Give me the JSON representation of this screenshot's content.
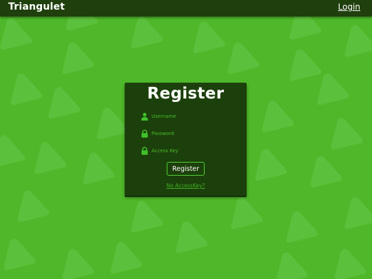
{
  "app": {
    "brand": "Triangulet"
  },
  "topbar": {
    "login_label": "Login"
  },
  "register": {
    "title": "Register",
    "fields": {
      "username": {
        "icon": "user-icon",
        "placeholder": "Username",
        "value": ""
      },
      "password": {
        "icon": "lock-icon",
        "placeholder": "Password",
        "value": ""
      },
      "access_key": {
        "icon": "lock-icon",
        "placeholder": "Access Key",
        "value": ""
      }
    },
    "submit_label": "Register",
    "no_access_key_link": "No AccessKey?"
  },
  "colors": {
    "background": "#4fb82a",
    "topbar": "#1f3f0c",
    "card": "#1c400b",
    "accent": "#4fd132",
    "input_text": "#48b82a"
  }
}
